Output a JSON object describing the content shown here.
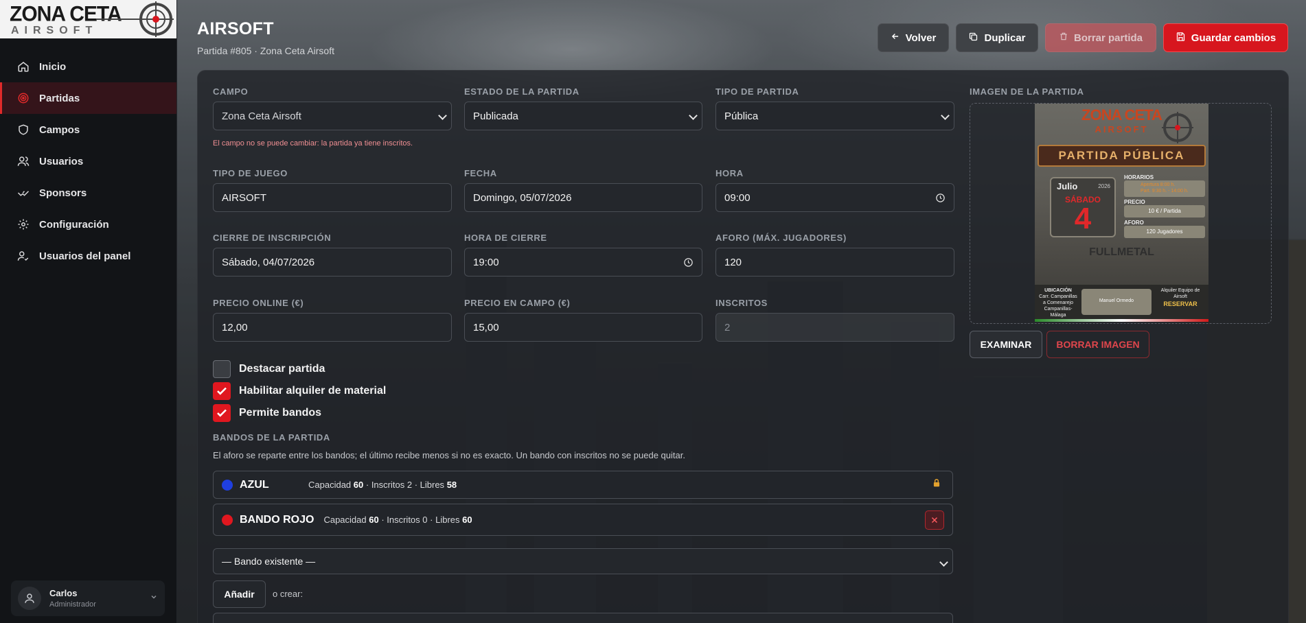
{
  "sidebar": {
    "logo": {
      "word1": "ZONA",
      "word2": "CETA",
      "sub": "AIRSOFT"
    },
    "items": [
      {
        "label": "Inicio",
        "icon": "home-icon",
        "active": false
      },
      {
        "label": "Partidas",
        "icon": "target-icon",
        "active": true
      },
      {
        "label": "Campos",
        "icon": "shield-icon",
        "active": false
      },
      {
        "label": "Usuarios",
        "icon": "users-icon",
        "active": false
      },
      {
        "label": "Sponsors",
        "icon": "handshake-icon",
        "active": false
      },
      {
        "label": "Configuración",
        "icon": "gear-icon",
        "active": false
      },
      {
        "label": "Usuarios del panel",
        "icon": "user-check-icon",
        "active": false
      }
    ],
    "user": {
      "name": "Carlos",
      "role": "Administrador"
    }
  },
  "header": {
    "title": "AIRSOFT",
    "subtitle": "Partida #805 · Zona Ceta Airsoft",
    "buttons": {
      "back": "Volver",
      "duplicate": "Duplicar",
      "delete": "Borrar partida",
      "save": "Guardar cambios"
    }
  },
  "form": {
    "campo": {
      "label": "CAMPO",
      "value": "Zona Ceta Airsoft",
      "hint": "El campo no se puede cambiar: la partida ya tiene inscritos."
    },
    "estado": {
      "label": "ESTADO DE LA PARTIDA",
      "value": "Publicada"
    },
    "tipo_partida": {
      "label": "TIPO DE PARTIDA",
      "value": "Pública"
    },
    "tipo_juego": {
      "label": "TIPO DE JUEGO",
      "value": "AIRSOFT"
    },
    "fecha": {
      "label": "FECHA",
      "value": "Domingo, 05/07/2026"
    },
    "hora": {
      "label": "HORA",
      "value": "09:00"
    },
    "cierre": {
      "label": "CIERRE DE INSCRIPCIÓN",
      "value": "Sábado, 04/07/2026"
    },
    "hora_cierre": {
      "label": "HORA DE CIERRE",
      "value": "19:00"
    },
    "aforo": {
      "label": "AFORO (MÁX. JUGADORES)",
      "value": "120"
    },
    "precio_online": {
      "label": "PRECIO ONLINE (€)",
      "value": "12,00"
    },
    "precio_campo": {
      "label": "PRECIO EN CAMPO (€)",
      "value": "15,00"
    },
    "inscritos": {
      "label": "INSCRITOS",
      "value": "2"
    },
    "checks": [
      {
        "label": "Destacar partida",
        "checked": false
      },
      {
        "label": "Habilitar alquiler de material",
        "checked": true
      },
      {
        "label": "Permite bandos",
        "checked": true
      }
    ],
    "bandos": {
      "title": "BANDOS DE LA PARTIDA",
      "desc": "El aforo se reparte entre los bandos; el último recibe menos si no es exacto. Un bando con inscritos no se puede quitar.",
      "items": [
        {
          "name": "AZUL",
          "color": "#1f3fe0",
          "cap_label": "Capacidad",
          "cap": "60",
          "ins_label": "Inscritos",
          "ins": "2",
          "lib_label": "Libres",
          "lib": "58"
        },
        {
          "name": "BANDO ROJO",
          "color": "#e0171f",
          "cap_label": "Capacidad",
          "cap": "60",
          "ins_label": "Inscritos",
          "ins": "0",
          "lib_label": "Libres",
          "lib": "60"
        }
      ],
      "select_placeholder": "— Bando existente —",
      "add_label": "Añadir",
      "or_create": "o crear:"
    }
  },
  "image": {
    "label": "IMAGEN DE LA PARTIDA",
    "browse": "EXAMINAR",
    "remove": "BORRAR IMAGEN",
    "poster": {
      "brand1": "ZONA CETA",
      "brand2": "AIRSOFT",
      "banner": "PARTIDA PÚBLICA",
      "month": "Julio",
      "year": "2026",
      "weekday": "SÁBADO",
      "day": "4",
      "horarios": "HORARIOS",
      "apertura": "Apertura 8:00 h.",
      "partida": "Part. 9:30 h. - 14:00 h.",
      "precio": "PRECIO",
      "precio_val": "10 € / Partida",
      "aforo": "AFORO",
      "aforo_val": "120 Jugadores",
      "sponsor": "FULLMETAL",
      "ubicacion": "UBICACIÓN",
      "direccion": "Carr. Campanillas a Comenarejo Campanillas-Málaga",
      "contacto": "Manuel Ormedo",
      "alquiler": "Alquiler Equipo de Airsoft",
      "reservar": "RESERVAR"
    }
  }
}
